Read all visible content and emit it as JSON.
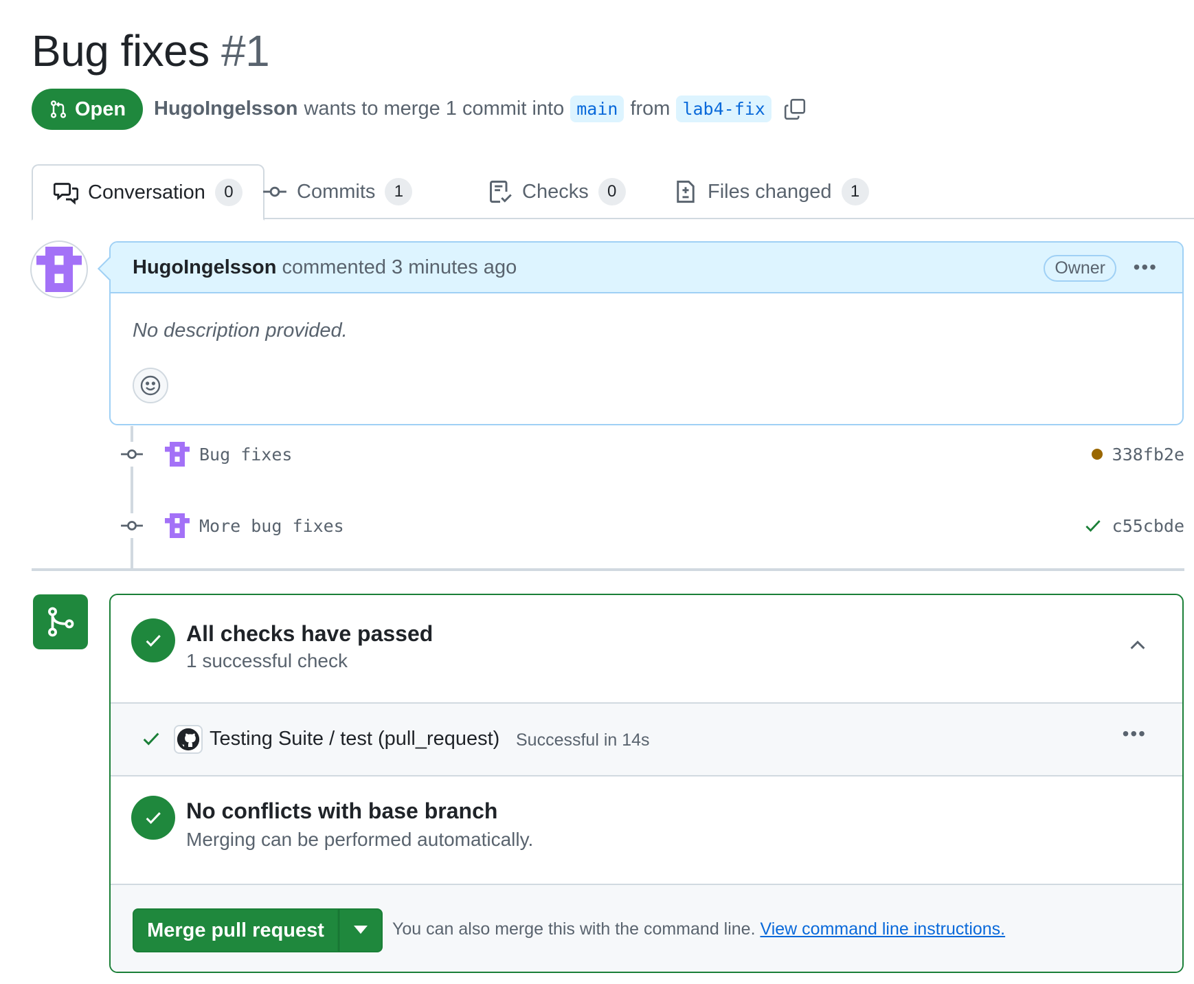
{
  "pr": {
    "title": "Bug fixes",
    "number": "#1",
    "state": "Open",
    "author": "HugoIngelsson",
    "meta_text": "wants to merge 1 commit into",
    "base_branch": "main",
    "from_text": "from",
    "head_branch": "lab4-fix"
  },
  "tabs": [
    {
      "label": "Conversation",
      "count": "0",
      "icon": "comment-discussion-icon"
    },
    {
      "label": "Commits",
      "count": "1",
      "icon": "git-commit-icon"
    },
    {
      "label": "Checks",
      "count": "0",
      "icon": "checklist-icon"
    },
    {
      "label": "Files changed",
      "count": "1",
      "icon": "file-diff-icon"
    }
  ],
  "comment": {
    "author": "HugoIngelsson",
    "action": "commented 3 minutes ago",
    "badge": "Owner",
    "body": "No description provided."
  },
  "commits": [
    {
      "message": "Bug fixes",
      "sha": "338fb2e",
      "status": "pending"
    },
    {
      "message": "More bug fixes",
      "sha": "c55cbde",
      "status": "success"
    }
  ],
  "merge_box": {
    "checks_title": "All checks have passed",
    "checks_sub": "1 successful check",
    "check_name": "Testing Suite / test (pull_request)",
    "check_status": "Successful in 14s",
    "conflicts_title": "No conflicts with base branch",
    "conflicts_sub": "Merging can be performed automatically.",
    "merge_button": "Merge pull request",
    "hint": "You can also merge this with the command line.",
    "hint_link": "View command line instructions."
  },
  "colors": {
    "success": "#1f883d",
    "accent": "#0969da",
    "comment_header": "#ddf4ff",
    "pending": "#9a6700",
    "avatar": "#a371f7"
  }
}
